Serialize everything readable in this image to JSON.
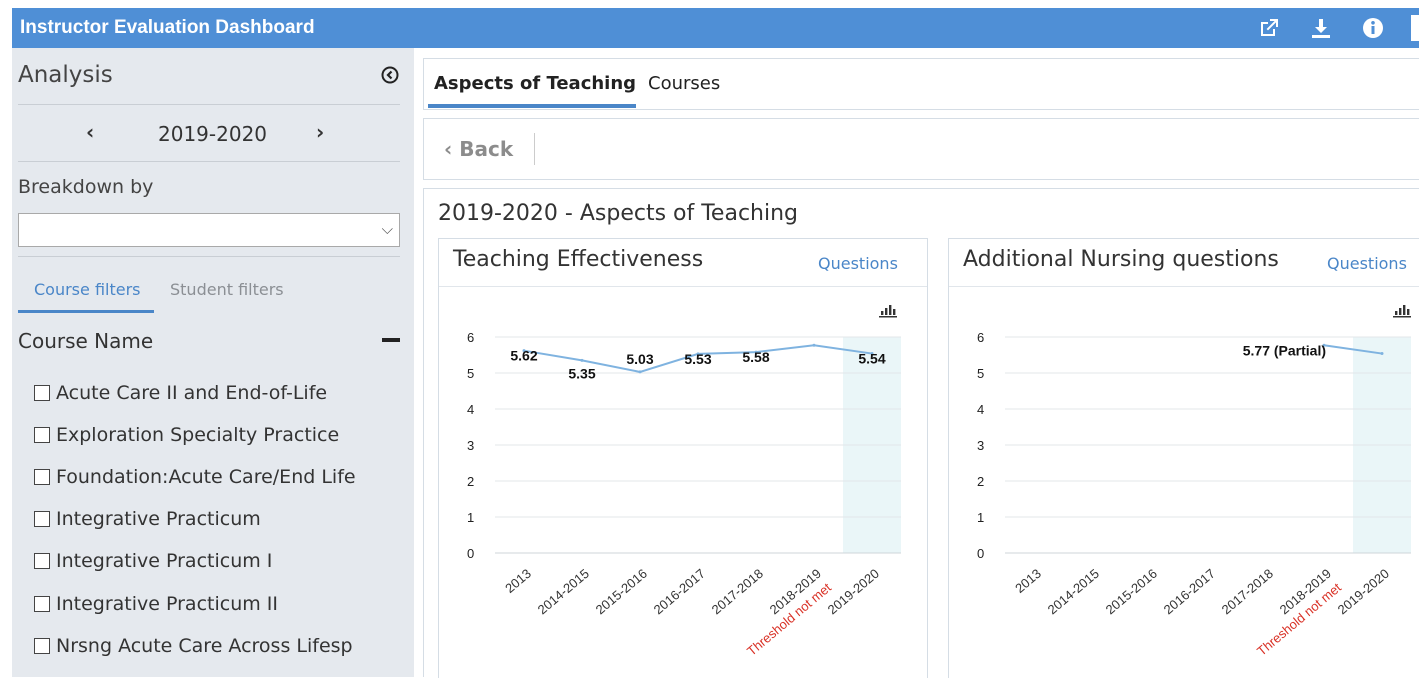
{
  "app": {
    "title": "Instructor Evaluation Dashboard",
    "actions": [
      "external-link-icon",
      "download-icon",
      "info-icon"
    ],
    "colors": {
      "header": "#4f8fd6",
      "accent": "#4a86c8",
      "sidebar": "#e5e9ee",
      "warning": "#d93025"
    }
  },
  "sidebar": {
    "heading": "Analysis",
    "year": "2019-2020",
    "breakdown_label": "Breakdown by",
    "breakdown_value": "",
    "filter_tabs": [
      "Course filters",
      "Student filters"
    ],
    "active_filter_tab": "Course filters",
    "course_heading": "Course Name",
    "courses": [
      "Acute Care II and End-of-Life",
      "Exploration Specialty Practice",
      "Foundation:Acute Care/End Life",
      "Integrative Practicum",
      "Integrative Practicum I",
      "Integrative Practicum II",
      "Nrsng Acute Care Across Lifesp"
    ]
  },
  "main": {
    "tabs": [
      "Aspects of Teaching",
      "Courses"
    ],
    "active_tab": "Aspects of Teaching",
    "back_label": "Back",
    "section_title": "2019-2020 - Aspects of Teaching",
    "cards": [
      {
        "title": "Teaching Effectiveness",
        "link": "Questions"
      },
      {
        "title": "Additional Nursing questions",
        "link": "Questions"
      }
    ]
  },
  "chart_data": [
    {
      "type": "line",
      "title": "Teaching Effectiveness",
      "categories": [
        "2013",
        "2014-2015",
        "2015-2016",
        "2016-2017",
        "2017-2018",
        "2018-2019",
        "2019-2020"
      ],
      "category_notes": {
        "2018-2019": "Threshold not met"
      },
      "values": [
        5.62,
        5.35,
        5.03,
        5.53,
        5.58,
        5.77,
        5.54
      ],
      "labels": [
        "5.62",
        "5.35",
        "5.03",
        "5.53",
        "5.58",
        "",
        "5.54"
      ],
      "highlighted_category": "2019-2020",
      "ylim": [
        0,
        6
      ],
      "yticks": [
        0,
        1,
        2,
        3,
        4,
        5,
        6
      ],
      "grid": true
    },
    {
      "type": "line",
      "title": "Additional Nursing questions",
      "categories": [
        "2013",
        "2014-2015",
        "2015-2016",
        "2016-2017",
        "2017-2018",
        "2018-2019",
        "2019-2020"
      ],
      "category_notes": {
        "2018-2019": "Threshold not met"
      },
      "values": [
        null,
        null,
        null,
        null,
        null,
        5.77,
        5.54
      ],
      "labels": [
        "",
        "",
        "",
        "",
        "",
        "5.77 (Partial)",
        ""
      ],
      "highlighted_category": "2019-2020",
      "ylim": [
        0,
        6
      ],
      "yticks": [
        0,
        1,
        2,
        3,
        4,
        5,
        6
      ],
      "grid": true
    }
  ]
}
